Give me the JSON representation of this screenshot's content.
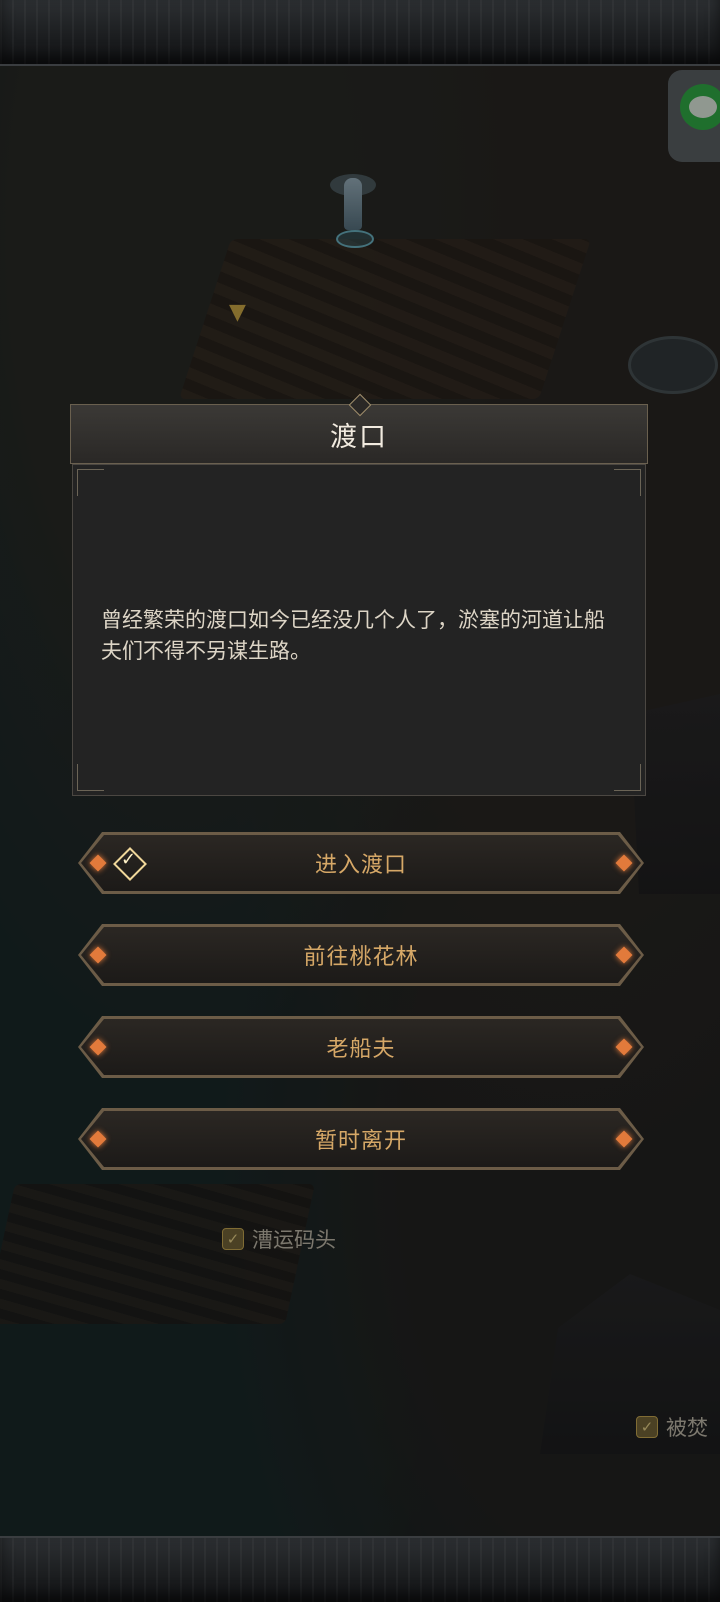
{
  "dialog": {
    "title": "渡口",
    "description": "曾经繁荣的渡口如今已经没几个人了，淤塞的河道让船夫们不得不另谋生路。"
  },
  "options": [
    {
      "label": "进入渡口",
      "has_quest_icon": true
    },
    {
      "label": "前往桃花林",
      "has_quest_icon": false
    },
    {
      "label": "老船夫",
      "has_quest_icon": false
    },
    {
      "label": "暂时离开",
      "has_quest_icon": false
    }
  ],
  "map_labels": {
    "pier": "漕运码头",
    "burned": "被焚"
  },
  "icons": {
    "chat": "chat-icon",
    "quest": "quest-check-icon",
    "marker": "location-marker-icon"
  },
  "colors": {
    "option_text": "#d6a867",
    "gem": "#e27a3b",
    "chat_green": "#33b34a"
  }
}
